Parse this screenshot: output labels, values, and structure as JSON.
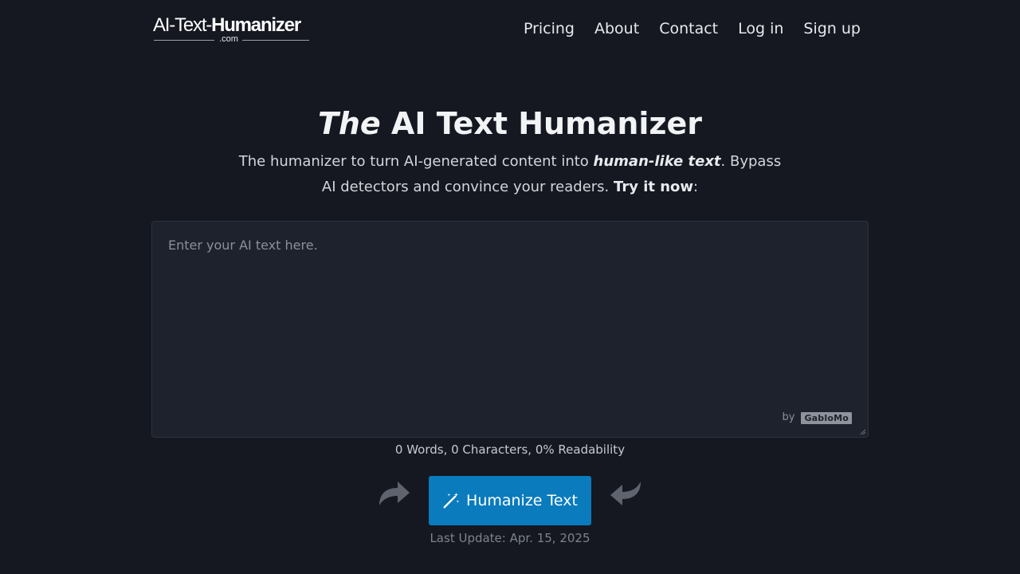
{
  "logo": {
    "part1": "AI-Text-",
    "part2": "Humanizer",
    "domain": ".com"
  },
  "nav": {
    "items": [
      "Pricing",
      "About",
      "Contact",
      "Log in",
      "Sign up"
    ]
  },
  "hero": {
    "title_italic": "The",
    "title_rest": " AI Text Humanizer",
    "sub_1": "The humanizer to turn AI-generated content into ",
    "sub_emph": "human-like text",
    "sub_2": ". Bypass AI detectors and convince your readers. ",
    "sub_cta": "Try it now",
    "sub_end": ":"
  },
  "editor": {
    "value": "",
    "placeholder": "Enter your AI text here.",
    "by_label": "by",
    "brand_badge": "GabloMo"
  },
  "stats": "0 Words, 0 Characters, 0% Readability",
  "action": {
    "button_label": "Humanize Text",
    "icon": "magic-wand-icon"
  },
  "updated": "Last Update: Apr. 15, 2025",
  "colors": {
    "background": "#151821",
    "panel": "#1e222d",
    "button": "#0a7bbd",
    "arrow": "#5e636d"
  }
}
